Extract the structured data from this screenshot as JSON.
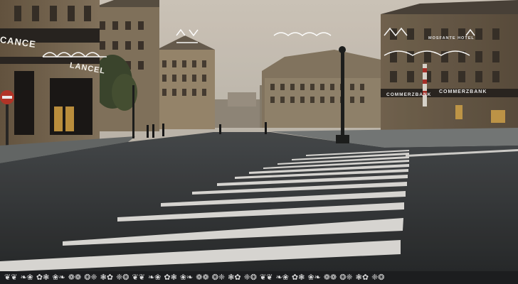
{
  "scene": {
    "signs": {
      "left_shop_line1": "CANCE",
      "left_shop_line2": "LANCEL",
      "right_hotel_1": "COMMERZBANK",
      "right_hotel_2": "COMMERZBANK",
      "right_hotel_3": "MOSFANTE HOTEL"
    }
  },
  "ornaments": {
    "count": 24
  }
}
